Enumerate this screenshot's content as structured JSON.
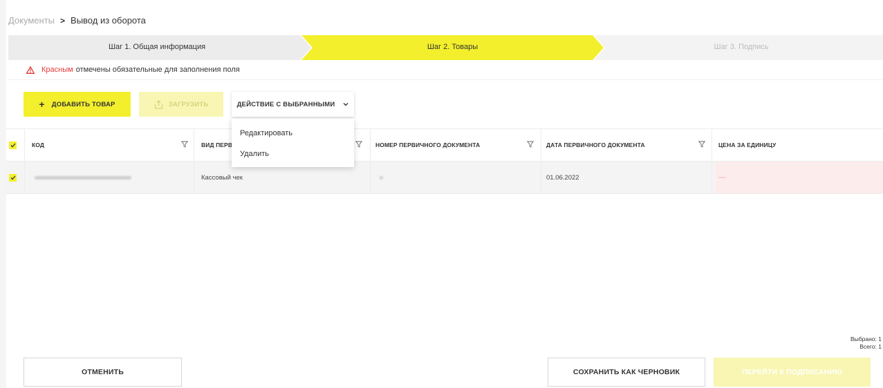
{
  "breadcrumb": {
    "parent": "Документы",
    "separator": ">",
    "current": "Вывод из оборота"
  },
  "steps": [
    {
      "label": "Шаг 1. Общая информация",
      "state": "done"
    },
    {
      "label": "Шаг 2. Товары",
      "state": "active"
    },
    {
      "label": "Шаг 3. Подпись",
      "state": "pending"
    }
  ],
  "notice": {
    "highlight": "Красным",
    "text": "отмечены обязательные для заполнения поля"
  },
  "toolbar": {
    "add_label": "ДОБАВИТЬ ТОВАР",
    "upload_label": "ЗАГРУЗИТЬ",
    "actions_label": "ДЕЙСТВИЕ С ВЫБРАННЫМИ"
  },
  "actions_menu": {
    "items": [
      "Редактировать",
      "Удалить"
    ]
  },
  "table": {
    "columns": [
      "КОД",
      "ВИД ПЕРВИЧНОГО ДОКУМЕНТА",
      "НОМЕР ПЕРВИЧНОГО ДОКУМЕНТА",
      "ДАТА ПЕРВИЧНОГО ДОКУМЕНТА",
      "ЦЕНА ЗА ЕДИНИЦУ"
    ],
    "rows": [
      {
        "checked": true,
        "code": "",
        "doc_type": "Кассовый чек",
        "doc_number": "",
        "doc_date": "01.06.2022",
        "price": "—"
      }
    ]
  },
  "counts": {
    "selected": "Выбрано: 1",
    "total": "Всего: 1"
  },
  "footer": {
    "cancel_label": "ОТМЕНИТЬ",
    "draft_label": "СОХРАНИТЬ КАК ЧЕРНОВИК",
    "sign_label": "ПЕРЕЙТИ К ПОДПИСАНИЮ"
  },
  "colors": {
    "accent": "#f3ef2c",
    "accent_disabled": "#f8f6b2",
    "error": "#e53935"
  }
}
